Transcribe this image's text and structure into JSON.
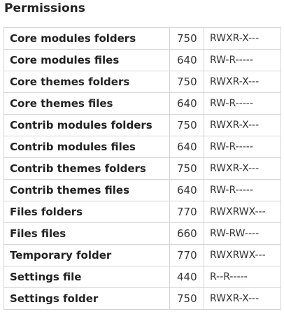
{
  "section": {
    "title": "Permissions"
  },
  "permissions": {
    "rows": [
      {
        "name": "Core modules folders",
        "octal": "750",
        "symbolic": "RWXR-X---"
      },
      {
        "name": "Core modules files",
        "octal": "640",
        "symbolic": "RW-R-----"
      },
      {
        "name": "Core themes folders",
        "octal": "750",
        "symbolic": "RWXR-X---"
      },
      {
        "name": "Core themes files",
        "octal": "640",
        "symbolic": "RW-R-----"
      },
      {
        "name": "Contrib modules folders",
        "octal": "750",
        "symbolic": "RWXR-X---"
      },
      {
        "name": "Contrib modules files",
        "octal": "640",
        "symbolic": "RW-R-----"
      },
      {
        "name": "Contrib themes folders",
        "octal": "750",
        "symbolic": "RWXR-X---"
      },
      {
        "name": "Contrib themes files",
        "octal": "640",
        "symbolic": "RW-R-----"
      },
      {
        "name": "Files folders",
        "octal": "770",
        "symbolic": "RWXRWX---"
      },
      {
        "name": "Files files",
        "octal": "660",
        "symbolic": "RW-RW----"
      },
      {
        "name": "Temporary folder",
        "octal": "770",
        "symbolic": "RWXRWX---"
      },
      {
        "name": "Settings file",
        "octal": "440",
        "symbolic": "R--R-----"
      },
      {
        "name": "Settings folder",
        "octal": "750",
        "symbolic": "RWXR-X---"
      }
    ]
  }
}
